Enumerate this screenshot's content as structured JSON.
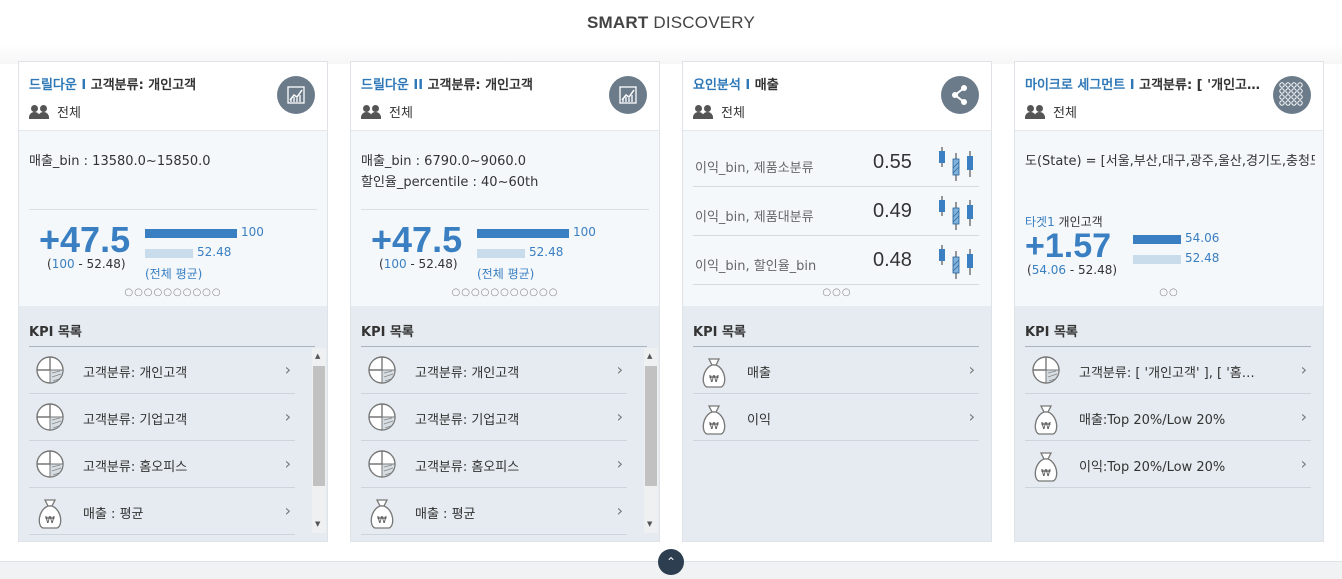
{
  "header": {
    "title_bold": "SMART",
    "title_rest": " DISCOVERY"
  },
  "colors": {
    "accent": "#3a7fc1",
    "icon_bg": "#6b7b8a",
    "kpi_bg": "#e5ebf0"
  },
  "cards": [
    {
      "cat": "드릴다운 I",
      "title": " 고객분류: 개인고객",
      "sub": "전체",
      "icon": "growth-chart-icon",
      "cond1": "매출_bin : 13580.0~15850.0",
      "cond2": "",
      "big": "+47.5",
      "paren_a": "100",
      "paren_rest": " - 52.48)",
      "bar1": "100",
      "bar2": "52.48",
      "bar2_frac": 0.5248,
      "avg": "(전체 평균)",
      "dots": "○○○○○○○○○○",
      "kpi_title": "KPI 목록",
      "kpis": [
        {
          "icon": "pie-icon",
          "label": "고객분류: 개인고객"
        },
        {
          "icon": "pie-icon",
          "label": "고객분류: 기업고객"
        },
        {
          "icon": "pie-icon",
          "label": "고객분류: 홈오피스"
        },
        {
          "icon": "money-bag-icon",
          "label": "매출 : 평균"
        }
      ]
    },
    {
      "cat": "드릴다운 II",
      "title": " 고객분류: 개인고객",
      "sub": "전체",
      "icon": "growth-chart-icon",
      "cond1": "매출_bin : 6790.0~9060.0",
      "cond2": "할인율_percentile : 40~60th",
      "big": "+47.5",
      "paren_a": "100",
      "paren_rest": " - 52.48)",
      "bar1": "100",
      "bar2": "52.48",
      "bar2_frac": 0.5248,
      "avg": "(전체 평균)",
      "dots": "○○○○○○○○○○○",
      "kpi_title": "KPI 목록",
      "kpis": [
        {
          "icon": "pie-icon",
          "label": "고객분류: 개인고객"
        },
        {
          "icon": "pie-icon",
          "label": "고객분류: 기업고객"
        },
        {
          "icon": "pie-icon",
          "label": "고객분류: 홈오피스"
        },
        {
          "icon": "money-bag-icon",
          "label": "매출 : 평균"
        }
      ]
    },
    {
      "cat": "요인분석 I",
      "title": " 매출",
      "sub": "전체",
      "icon": "share-icon",
      "factors": [
        {
          "label": "이익_bin, 제품소분류",
          "value": "0.55"
        },
        {
          "label": "이익_bin, 제품대분류",
          "value": "0.49"
        },
        {
          "label": "이익_bin, 할인율_bin",
          "value": "0.48"
        }
      ],
      "dots": "○○○",
      "kpi_title": "KPI 목록",
      "kpis": [
        {
          "icon": "money-bag-icon",
          "label": "매출"
        },
        {
          "icon": "money-bag-icon",
          "label": "이익"
        }
      ]
    },
    {
      "cat": "마이크로 세그먼트 I",
      "title": " 고객분류: [ '개인고객', '기업고객' ]",
      "sub": "전체",
      "icon": "dots-grid-icon",
      "cond1": "도(State) = [서울,부산,대구,광주,울산,경기도,충청도,전라도]",
      "tgt_label": "타겟1",
      "tgt_value": " 개인고객",
      "big": "+1.57",
      "paren_a": "54.06",
      "paren_rest": " - 52.48)",
      "bar1": "54.06",
      "bar2": "52.48",
      "bar2_frac": 0.5248,
      "dots": "○○",
      "kpi_title": "KPI 목록",
      "kpis": [
        {
          "icon": "pie-icon",
          "label": "고객분류: [ '개인고객' ], [ '홈오피스' ]"
        },
        {
          "icon": "money-bag-icon",
          "label": "매출:Top 20%/Low 20%"
        },
        {
          "icon": "money-bag-icon",
          "label": "이익:Top 20%/Low 20%"
        }
      ]
    }
  ]
}
